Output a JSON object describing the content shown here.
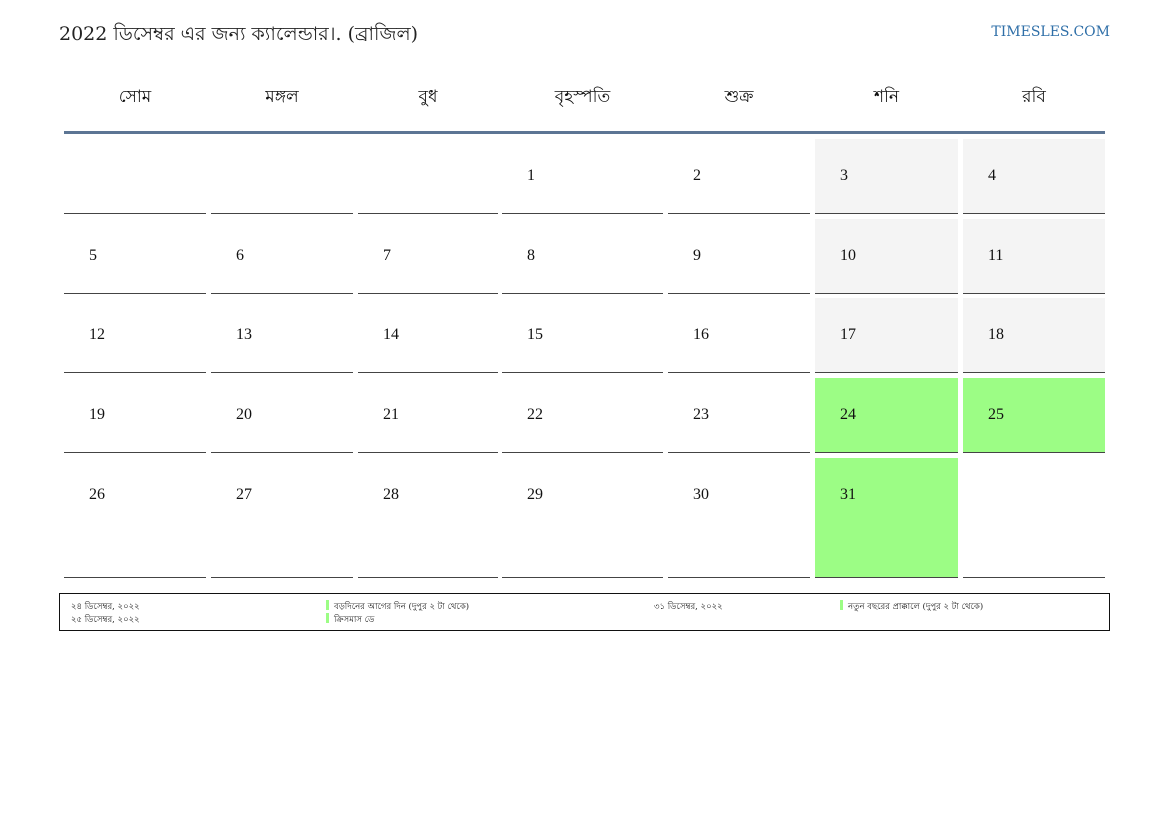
{
  "header": {
    "title": "2022 ডিসেম্বর এর জন্য ক্যালেন্ডার।. (ব্রাজিল)",
    "site": "TIMESLES.COM"
  },
  "weekdays": [
    "সোম",
    "মঙ্গল",
    "বুধ",
    "বৃহস্পতি",
    "শুক্র",
    "শনি",
    "রবি"
  ],
  "weeks": [
    [
      "",
      "",
      "",
      "1",
      "2",
      "3",
      "4"
    ],
    [
      "5",
      "6",
      "7",
      "8",
      "9",
      "10",
      "11"
    ],
    [
      "12",
      "13",
      "14",
      "15",
      "16",
      "17",
      "18"
    ],
    [
      "19",
      "20",
      "21",
      "22",
      "23",
      "24",
      "25"
    ],
    [
      "26",
      "27",
      "28",
      "29",
      "30",
      "31",
      ""
    ]
  ],
  "holidays": [
    "24",
    "25",
    "31"
  ],
  "colors": {
    "holiday": "#9cfd85",
    "weekend": "#f4f4f4",
    "accent": "#5c7594",
    "link": "#2f6fa8"
  },
  "legend": [
    {
      "date": "২৪ ডিসেম্বর, ২০২২",
      "name": "বড়দিনের আগের দিন (দুপুর ২ টা থেকে)"
    },
    {
      "date": "২৫ ডিসেম্বর, ২০২২",
      "name": "ক্রিসমাস ডে"
    },
    {
      "date": "৩১ ডিসেম্বর, ২০২২",
      "name": "নতুন বছরের প্রাক্কালে (দুপুর ২ টা থেকে)"
    }
  ]
}
